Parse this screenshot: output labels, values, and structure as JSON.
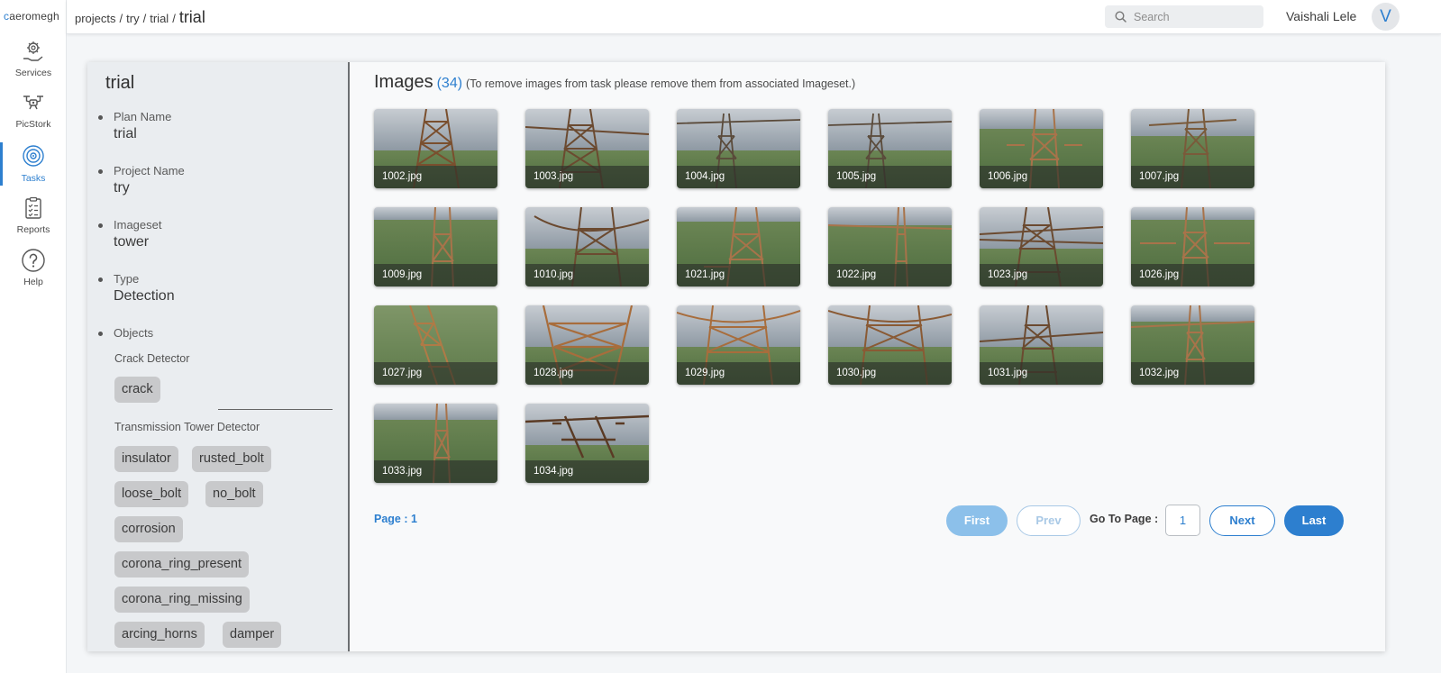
{
  "brand": {
    "logo_text": "aeromegh"
  },
  "nav": {
    "items": [
      {
        "label": "Services",
        "icon": "services-gear-hand-icon"
      },
      {
        "label": "PicStork",
        "icon": "drone-icon"
      },
      {
        "label": "Tasks",
        "icon": "tasks-target-icon"
      },
      {
        "label": "Reports",
        "icon": "clipboard-icon"
      },
      {
        "label": "Help",
        "icon": "help-question-icon"
      }
    ],
    "active": "Tasks"
  },
  "header": {
    "breadcrumb": [
      "projects",
      "try",
      "trial"
    ],
    "current": "trial",
    "search_placeholder": "Search",
    "user_name": "Vaishali Lele",
    "avatar_initial": "V"
  },
  "task": {
    "title": "trial",
    "fields": [
      {
        "label": "Plan Name",
        "value": "trial"
      },
      {
        "label": "Project Name",
        "value": "try"
      },
      {
        "label": "Imageset",
        "value": "tower"
      },
      {
        "label": "Type",
        "value": "Detection"
      }
    ],
    "objects_label": "Objects",
    "detectors": [
      {
        "name": "Crack Detector",
        "objects": [
          "crack"
        ]
      },
      {
        "name": "Transmission Tower Detector",
        "objects": [
          "insulator",
          "rusted_bolt",
          "loose_bolt",
          "no_bolt",
          "corrosion",
          "corona_ring_present",
          "corona_ring_missing",
          "arcing_horns",
          "damper"
        ]
      }
    ]
  },
  "images": {
    "title": "Images",
    "count": "(34)",
    "note": "(To remove images from task please remove them from associated Imageset.)",
    "items": [
      "1002.jpg",
      "1003.jpg",
      "1004.jpg",
      "1005.jpg",
      "1006.jpg",
      "1007.jpg",
      "1009.jpg",
      "1010.jpg",
      "1021.jpg",
      "1022.jpg",
      "1023.jpg",
      "1026.jpg",
      "1027.jpg",
      "1028.jpg",
      "1029.jpg",
      "1030.jpg",
      "1031.jpg",
      "1032.jpg",
      "1033.jpg",
      "1034.jpg"
    ]
  },
  "pagination": {
    "page_label": "Page : 1",
    "first": "First",
    "prev": "Prev",
    "goto_label": "Go To Page :",
    "goto_value": "1",
    "next": "Next",
    "last": "Last"
  },
  "colors": {
    "accent": "#2d7fcf",
    "accent_light": "#8cc0ea",
    "tag_bg": "#c8c9cb",
    "panel_bg": "#eaedf0"
  }
}
